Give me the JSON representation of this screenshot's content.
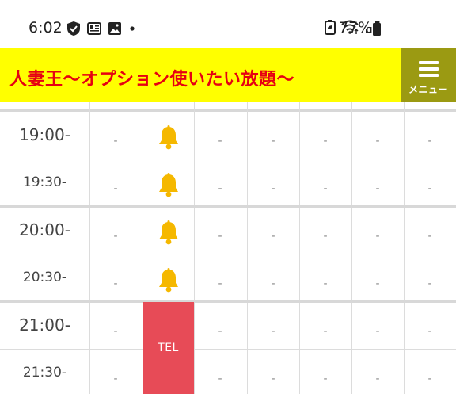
{
  "status_bar": {
    "time": "6:02",
    "battery_percent": "77%",
    "icons_left": [
      "shield-check-icon",
      "news-icon",
      "image-icon",
      "dot-icon"
    ],
    "icons_right": [
      "battery-saver-icon",
      "wifi-icon",
      "signal-icon",
      "battery-icon"
    ]
  },
  "header": {
    "title": "人妻王～オプション使いたい放題～",
    "menu_label": "メニュー",
    "colors": {
      "background": "#ffff00",
      "title": "#e60012",
      "menu_background": "#9b9a12"
    }
  },
  "schedule": {
    "rows": [
      {
        "time": "19:00-",
        "kind": "hour",
        "cells": [
          "-",
          "bell",
          "-",
          "-",
          "-",
          "-",
          "-"
        ]
      },
      {
        "time": "19:30-",
        "kind": "half",
        "cells": [
          "-",
          "bell",
          "-",
          "-",
          "-",
          "-",
          "-"
        ]
      },
      {
        "time": "20:00-",
        "kind": "hour",
        "cells": [
          "-",
          "bell",
          "-",
          "-",
          "-",
          "-",
          "-"
        ]
      },
      {
        "time": "20:30-",
        "kind": "half",
        "cells": [
          "-",
          "bell",
          "-",
          "-",
          "-",
          "-",
          "-"
        ]
      },
      {
        "time": "21:00-",
        "kind": "hour",
        "cells": [
          "-",
          "tel",
          "-",
          "-",
          "-",
          "-",
          "-"
        ]
      },
      {
        "time": "21:30-",
        "kind": "half",
        "cells": [
          "-",
          "tel",
          "-",
          "-",
          "-",
          "-",
          "-"
        ]
      }
    ],
    "dash_text": "-",
    "tel_label": "TEL",
    "colors": {
      "bell": "#f5b800",
      "tel": "#e74b57"
    }
  }
}
